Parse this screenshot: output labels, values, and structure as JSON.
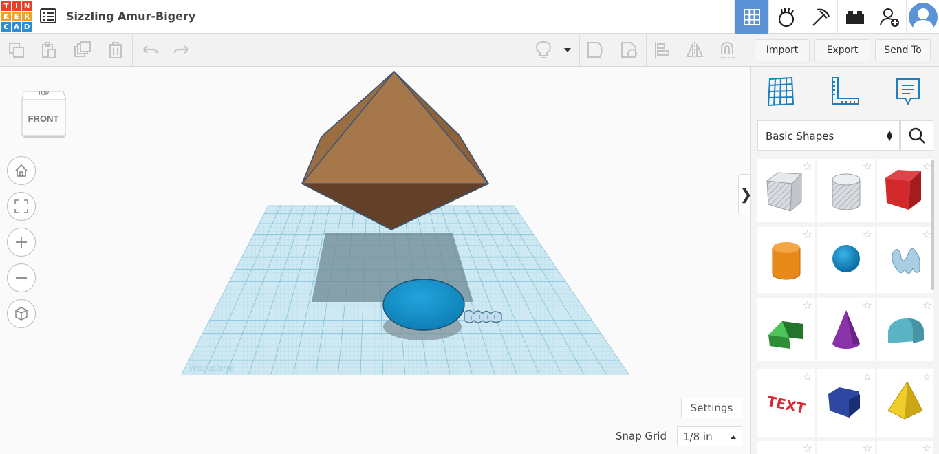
{
  "app": {
    "logo_letters": [
      "T",
      "I",
      "N",
      "K",
      "E",
      "R",
      "C",
      "A",
      "D"
    ],
    "logo_colors": [
      "#e8412c",
      "#e8412c",
      "#e8412c",
      "#f2a12c",
      "#f2a12c",
      "#f2a12c",
      "#2c8fd6",
      "#2c8fd6",
      "#2c8fd6"
    ],
    "design_title": "Sizzling Amur-Bigery"
  },
  "header_right": {
    "buttons": [
      "grid-view-icon",
      "tinker-hand-icon",
      "pickaxe-icon",
      "bricks-icon",
      "add-user-icon",
      "user-avatar"
    ],
    "active_color": "#5b93d6"
  },
  "toolbar": {
    "import_label": "Import",
    "export_label": "Export",
    "send_to_label": "Send To"
  },
  "viewcube": {
    "top_label": "TOP",
    "front_label": "FRONT"
  },
  "canvas": {
    "workplane_label": "Workplane",
    "settings_label": "Settings",
    "snap_grid_label": "Snap Grid",
    "snap_grid_value": "1/8 in"
  },
  "panel": {
    "category": "Basic Shapes",
    "shapes": [
      {
        "name": "Box (hole)",
        "icon": "box-hole-icon"
      },
      {
        "name": "Cylinder (hole)",
        "icon": "cylinder-hole-icon"
      },
      {
        "name": "Box",
        "icon": "box-icon",
        "color": "#d22a2a"
      },
      {
        "name": "Cylinder",
        "icon": "cylinder-icon",
        "color": "#e88a1a"
      },
      {
        "name": "Sphere",
        "icon": "sphere-icon",
        "color": "#1a8fc9"
      },
      {
        "name": "Scribble",
        "icon": "scribble-icon",
        "color": "#9cc3dc"
      },
      {
        "name": "Roof",
        "icon": "roof-icon",
        "color": "#2e9e3b"
      },
      {
        "name": "Cone",
        "icon": "cone-icon",
        "color": "#8a33a8"
      },
      {
        "name": "Round Roof",
        "icon": "round-roof-icon",
        "color": "#5bb4c6"
      },
      {
        "name": "Text",
        "icon": "text-icon",
        "color": "#d42b36",
        "text": "TEXT"
      },
      {
        "name": "Polygon",
        "icon": "polygon-icon",
        "color": "#243a8c"
      },
      {
        "name": "Pyramid",
        "icon": "pyramid-icon",
        "color": "#e8c21a"
      }
    ]
  },
  "scene": {
    "diamond_top": "#a5774b",
    "diamond_bottom": "#624029",
    "ellipsoid": "#1a8fc9",
    "workplane": "#cde8f2"
  }
}
